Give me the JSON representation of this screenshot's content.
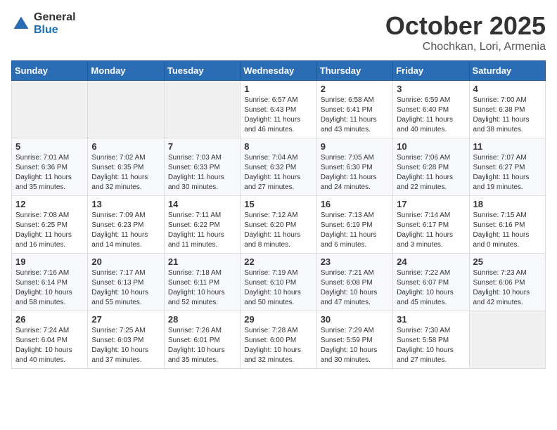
{
  "header": {
    "logo_general": "General",
    "logo_blue": "Blue",
    "title": "October 2025",
    "location": "Chochkan, Lori, Armenia"
  },
  "weekdays": [
    "Sunday",
    "Monday",
    "Tuesday",
    "Wednesday",
    "Thursday",
    "Friday",
    "Saturday"
  ],
  "weeks": [
    [
      {
        "day": "",
        "sunrise": "",
        "sunset": "",
        "daylight": ""
      },
      {
        "day": "",
        "sunrise": "",
        "sunset": "",
        "daylight": ""
      },
      {
        "day": "",
        "sunrise": "",
        "sunset": "",
        "daylight": ""
      },
      {
        "day": "1",
        "sunrise": "Sunrise: 6:57 AM",
        "sunset": "Sunset: 6:43 PM",
        "daylight": "Daylight: 11 hours and 46 minutes."
      },
      {
        "day": "2",
        "sunrise": "Sunrise: 6:58 AM",
        "sunset": "Sunset: 6:41 PM",
        "daylight": "Daylight: 11 hours and 43 minutes."
      },
      {
        "day": "3",
        "sunrise": "Sunrise: 6:59 AM",
        "sunset": "Sunset: 6:40 PM",
        "daylight": "Daylight: 11 hours and 40 minutes."
      },
      {
        "day": "4",
        "sunrise": "Sunrise: 7:00 AM",
        "sunset": "Sunset: 6:38 PM",
        "daylight": "Daylight: 11 hours and 38 minutes."
      }
    ],
    [
      {
        "day": "5",
        "sunrise": "Sunrise: 7:01 AM",
        "sunset": "Sunset: 6:36 PM",
        "daylight": "Daylight: 11 hours and 35 minutes."
      },
      {
        "day": "6",
        "sunrise": "Sunrise: 7:02 AM",
        "sunset": "Sunset: 6:35 PM",
        "daylight": "Daylight: 11 hours and 32 minutes."
      },
      {
        "day": "7",
        "sunrise": "Sunrise: 7:03 AM",
        "sunset": "Sunset: 6:33 PM",
        "daylight": "Daylight: 11 hours and 30 minutes."
      },
      {
        "day": "8",
        "sunrise": "Sunrise: 7:04 AM",
        "sunset": "Sunset: 6:32 PM",
        "daylight": "Daylight: 11 hours and 27 minutes."
      },
      {
        "day": "9",
        "sunrise": "Sunrise: 7:05 AM",
        "sunset": "Sunset: 6:30 PM",
        "daylight": "Daylight: 11 hours and 24 minutes."
      },
      {
        "day": "10",
        "sunrise": "Sunrise: 7:06 AM",
        "sunset": "Sunset: 6:28 PM",
        "daylight": "Daylight: 11 hours and 22 minutes."
      },
      {
        "day": "11",
        "sunrise": "Sunrise: 7:07 AM",
        "sunset": "Sunset: 6:27 PM",
        "daylight": "Daylight: 11 hours and 19 minutes."
      }
    ],
    [
      {
        "day": "12",
        "sunrise": "Sunrise: 7:08 AM",
        "sunset": "Sunset: 6:25 PM",
        "daylight": "Daylight: 11 hours and 16 minutes."
      },
      {
        "day": "13",
        "sunrise": "Sunrise: 7:09 AM",
        "sunset": "Sunset: 6:23 PM",
        "daylight": "Daylight: 11 hours and 14 minutes."
      },
      {
        "day": "14",
        "sunrise": "Sunrise: 7:11 AM",
        "sunset": "Sunset: 6:22 PM",
        "daylight": "Daylight: 11 hours and 11 minutes."
      },
      {
        "day": "15",
        "sunrise": "Sunrise: 7:12 AM",
        "sunset": "Sunset: 6:20 PM",
        "daylight": "Daylight: 11 hours and 8 minutes."
      },
      {
        "day": "16",
        "sunrise": "Sunrise: 7:13 AM",
        "sunset": "Sunset: 6:19 PM",
        "daylight": "Daylight: 11 hours and 6 minutes."
      },
      {
        "day": "17",
        "sunrise": "Sunrise: 7:14 AM",
        "sunset": "Sunset: 6:17 PM",
        "daylight": "Daylight: 11 hours and 3 minutes."
      },
      {
        "day": "18",
        "sunrise": "Sunrise: 7:15 AM",
        "sunset": "Sunset: 6:16 PM",
        "daylight": "Daylight: 11 hours and 0 minutes."
      }
    ],
    [
      {
        "day": "19",
        "sunrise": "Sunrise: 7:16 AM",
        "sunset": "Sunset: 6:14 PM",
        "daylight": "Daylight: 10 hours and 58 minutes."
      },
      {
        "day": "20",
        "sunrise": "Sunrise: 7:17 AM",
        "sunset": "Sunset: 6:13 PM",
        "daylight": "Daylight: 10 hours and 55 minutes."
      },
      {
        "day": "21",
        "sunrise": "Sunrise: 7:18 AM",
        "sunset": "Sunset: 6:11 PM",
        "daylight": "Daylight: 10 hours and 52 minutes."
      },
      {
        "day": "22",
        "sunrise": "Sunrise: 7:19 AM",
        "sunset": "Sunset: 6:10 PM",
        "daylight": "Daylight: 10 hours and 50 minutes."
      },
      {
        "day": "23",
        "sunrise": "Sunrise: 7:21 AM",
        "sunset": "Sunset: 6:08 PM",
        "daylight": "Daylight: 10 hours and 47 minutes."
      },
      {
        "day": "24",
        "sunrise": "Sunrise: 7:22 AM",
        "sunset": "Sunset: 6:07 PM",
        "daylight": "Daylight: 10 hours and 45 minutes."
      },
      {
        "day": "25",
        "sunrise": "Sunrise: 7:23 AM",
        "sunset": "Sunset: 6:06 PM",
        "daylight": "Daylight: 10 hours and 42 minutes."
      }
    ],
    [
      {
        "day": "26",
        "sunrise": "Sunrise: 7:24 AM",
        "sunset": "Sunset: 6:04 PM",
        "daylight": "Daylight: 10 hours and 40 minutes."
      },
      {
        "day": "27",
        "sunrise": "Sunrise: 7:25 AM",
        "sunset": "Sunset: 6:03 PM",
        "daylight": "Daylight: 10 hours and 37 minutes."
      },
      {
        "day": "28",
        "sunrise": "Sunrise: 7:26 AM",
        "sunset": "Sunset: 6:01 PM",
        "daylight": "Daylight: 10 hours and 35 minutes."
      },
      {
        "day": "29",
        "sunrise": "Sunrise: 7:28 AM",
        "sunset": "Sunset: 6:00 PM",
        "daylight": "Daylight: 10 hours and 32 minutes."
      },
      {
        "day": "30",
        "sunrise": "Sunrise: 7:29 AM",
        "sunset": "Sunset: 5:59 PM",
        "daylight": "Daylight: 10 hours and 30 minutes."
      },
      {
        "day": "31",
        "sunrise": "Sunrise: 7:30 AM",
        "sunset": "Sunset: 5:58 PM",
        "daylight": "Daylight: 10 hours and 27 minutes."
      },
      {
        "day": "",
        "sunrise": "",
        "sunset": "",
        "daylight": ""
      }
    ]
  ]
}
